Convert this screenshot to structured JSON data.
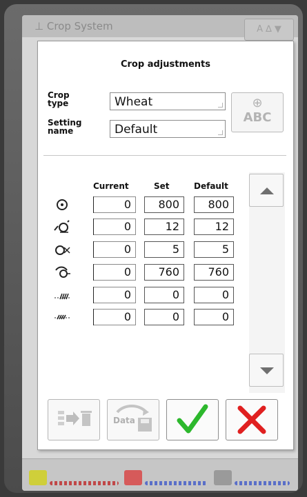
{
  "background_window": {
    "title": "Crop System",
    "tab_label": "A ∆ ▼"
  },
  "dialog": {
    "title": "Crop adjustments",
    "crop_type_label": "Crop\ntype",
    "crop_type_value": "Wheat",
    "setting_name_label": "Setting\nname",
    "setting_name_value": "Default",
    "abc_button": {
      "plus": "⊕",
      "label": "ABC"
    },
    "columns": {
      "current": "Current",
      "set": "Set",
      "default": "Default"
    },
    "rows": [
      {
        "icon": "drum-speed-icon",
        "current": "0",
        "set": "800",
        "default": "800"
      },
      {
        "icon": "concave-adjust-icon",
        "current": "0",
        "set": "12",
        "default": "12"
      },
      {
        "icon": "fan-speed-icon",
        "current": "0",
        "set": "5",
        "default": "5"
      },
      {
        "icon": "rotor-speed-icon",
        "current": "0",
        "set": "760",
        "default": "760"
      },
      {
        "icon": "upper-sieve-icon",
        "current": "0",
        "set": "0",
        "default": "0"
      },
      {
        "icon": "lower-sieve-icon",
        "current": "0",
        "set": "0",
        "default": "0"
      }
    ],
    "buttons": {
      "export_delete": "export-delete-icon",
      "data_save_label": "Data",
      "confirm": "checkmark-icon",
      "cancel": "cross-icon"
    }
  },
  "colors": {
    "confirm_green": "#2db82d",
    "cancel_red": "#e02020"
  }
}
